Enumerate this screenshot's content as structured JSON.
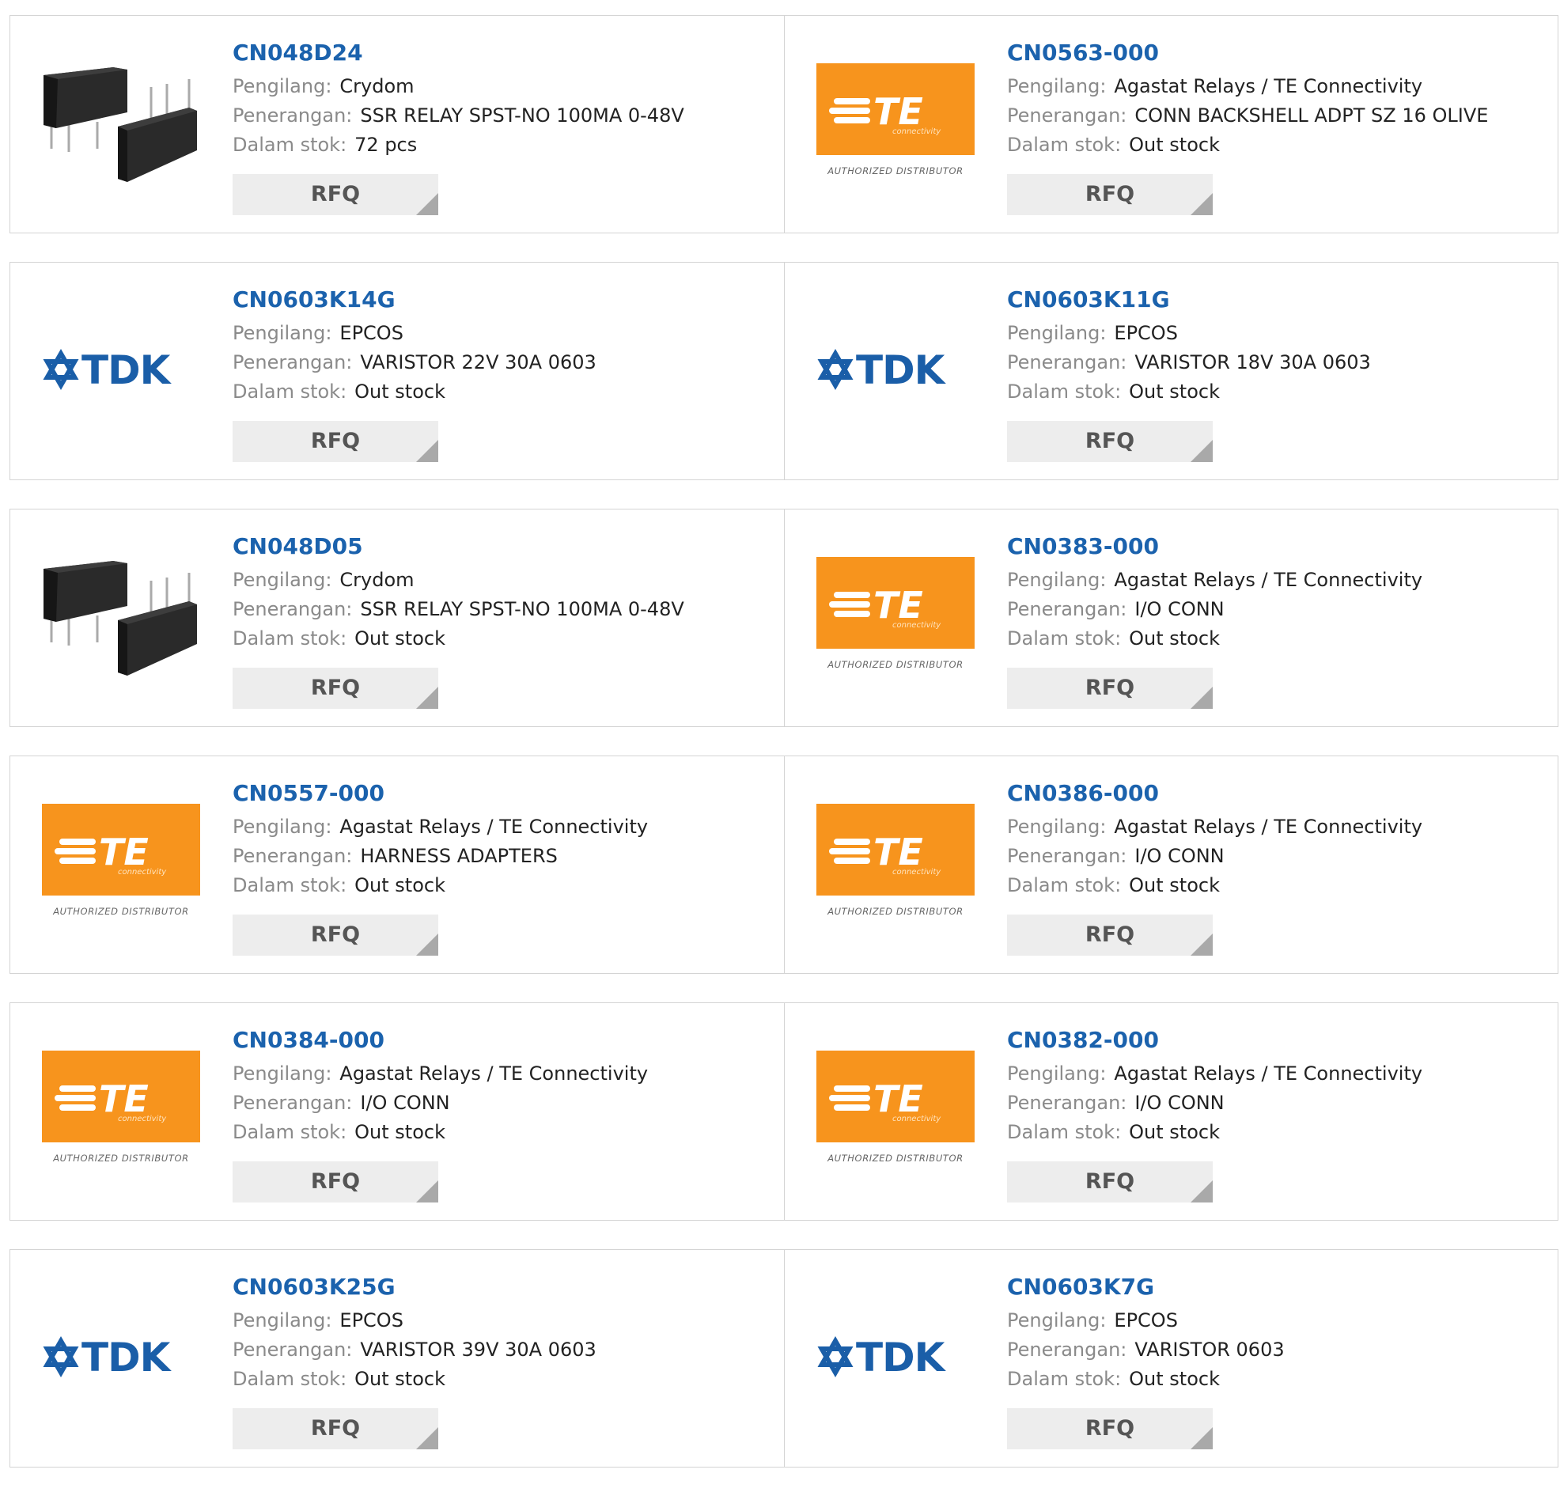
{
  "labels": {
    "manufacturer": "Pengilang:",
    "description": "Penerangan:",
    "stock": "Dalam stok:",
    "rfq": "RFQ"
  },
  "brand_colors": {
    "te_orange": "#f7941d",
    "tdk_blue": "#1a5ea8",
    "link_blue": "#1b62ad"
  },
  "logo_text": {
    "te": "TE",
    "te_sub": "connectivity",
    "te_tag": "AUTHORIZED DISTRIBUTOR",
    "tdk": "TDK"
  },
  "rows": [
    {
      "items": [
        {
          "part": "CN048D24",
          "manufacturer": "Crydom",
          "description": "SSR RELAY SPST-NO 100MA 0-48V",
          "stock": "72 pcs",
          "image": "relay-product-image"
        },
        {
          "part": "CN0563-000",
          "manufacturer": "Agastat Relays / TE Connectivity",
          "description": "CONN BACKSHELL ADPT SZ 16 OLIVE",
          "stock": "Out stock",
          "image": "te-logo"
        }
      ]
    },
    {
      "items": [
        {
          "part": "CN0603K14G",
          "manufacturer": "EPCOS",
          "description": "VARISTOR 22V 30A 0603",
          "stock": "Out stock",
          "image": "tdk-logo"
        },
        {
          "part": "CN0603K11G",
          "manufacturer": "EPCOS",
          "description": "VARISTOR 18V 30A 0603",
          "stock": "Out stock",
          "image": "tdk-logo"
        }
      ]
    },
    {
      "items": [
        {
          "part": "CN048D05",
          "manufacturer": "Crydom",
          "description": "SSR RELAY SPST-NO 100MA 0-48V",
          "stock": "Out stock",
          "image": "relay-product-image"
        },
        {
          "part": "CN0383-000",
          "manufacturer": "Agastat Relays / TE Connectivity",
          "description": "I/O CONN",
          "stock": "Out stock",
          "image": "te-logo"
        }
      ]
    },
    {
      "items": [
        {
          "part": "CN0557-000",
          "manufacturer": "Agastat Relays / TE Connectivity",
          "description": "HARNESS ADAPTERS",
          "stock": "Out stock",
          "image": "te-logo"
        },
        {
          "part": "CN0386-000",
          "manufacturer": "Agastat Relays / TE Connectivity",
          "description": "I/O CONN",
          "stock": "Out stock",
          "image": "te-logo"
        }
      ]
    },
    {
      "items": [
        {
          "part": "CN0384-000",
          "manufacturer": "Agastat Relays / TE Connectivity",
          "description": "I/O CONN",
          "stock": "Out stock",
          "image": "te-logo"
        },
        {
          "part": "CN0382-000",
          "manufacturer": "Agastat Relays / TE Connectivity",
          "description": "I/O CONN",
          "stock": "Out stock",
          "image": "te-logo"
        }
      ]
    },
    {
      "items": [
        {
          "part": "CN0603K25G",
          "manufacturer": "EPCOS",
          "description": "VARISTOR 39V 30A 0603",
          "stock": "Out stock",
          "image": "tdk-logo"
        },
        {
          "part": "CN0603K7G",
          "manufacturer": "EPCOS",
          "description": "VARISTOR 0603",
          "stock": "Out stock",
          "image": "tdk-logo"
        }
      ]
    }
  ]
}
